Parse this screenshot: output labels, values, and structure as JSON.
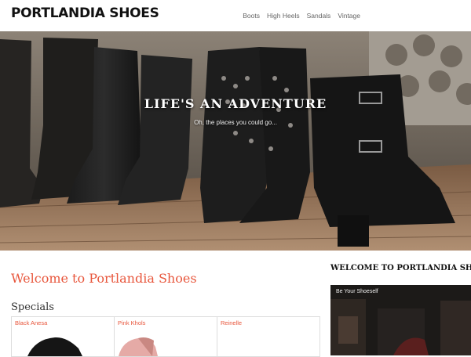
{
  "header": {
    "logo": "PORTLANDIA SHOES",
    "nav": [
      "Boots",
      "High Heels",
      "Sandals",
      "Vintage"
    ]
  },
  "hero": {
    "title": "LIFE'S AN ADVENTURE",
    "subtitle": "Oh, the places you could go..."
  },
  "main": {
    "welcome_title": "Welcome to Portlandia Shoes",
    "specials_title": "Specials",
    "specials": [
      "Black Anesa",
      "Pink Khols",
      "Reinelle"
    ]
  },
  "sidebar": {
    "title": "WELCOME TO PORTLANDIA SHOES",
    "video_title": "Be Your Shoeself"
  },
  "colors": {
    "accent": "#e8573d",
    "nav_text": "#666666",
    "logo": "#111111"
  }
}
